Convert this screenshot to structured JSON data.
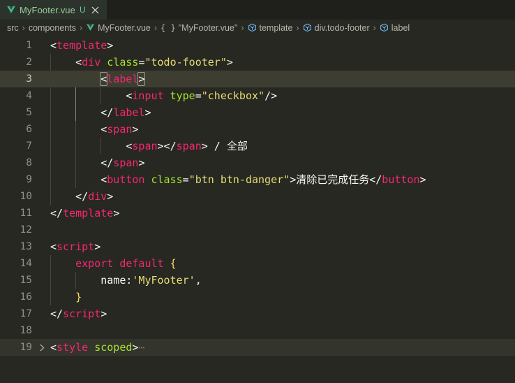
{
  "window": {
    "editor_bg": "#272822",
    "tabbar_bg": "#1f1f1c",
    "active_line_bg": "#3e3d32",
    "accent_green": "#73c991",
    "accent_blue": "#75beff"
  },
  "tabbar": {
    "tabs": [
      {
        "label": "MyFooter.vue",
        "icon": "vue-file-icon",
        "badge": "U",
        "close_icon": "close-icon",
        "active": true
      }
    ]
  },
  "breadcrumbs": {
    "separator": "›",
    "items": [
      {
        "label": "src",
        "icon": null
      },
      {
        "label": "components",
        "icon": null
      },
      {
        "label": "MyFooter.vue",
        "icon": "vue-file-icon"
      },
      {
        "label": "\"MyFooter.vue\"",
        "icon": "braces-icon"
      },
      {
        "label": "template",
        "icon": "symbol-field-icon"
      },
      {
        "label": "div.todo-footer",
        "icon": "symbol-field-icon"
      },
      {
        "label": "label",
        "icon": "symbol-field-icon"
      }
    ]
  },
  "editor": {
    "language": "vue",
    "active_line": 3,
    "cursor_line": 3,
    "lines": [
      {
        "num": "1",
        "indent": 0,
        "folded": false,
        "tokens": [
          {
            "t": "<",
            "c": "t-punc"
          },
          {
            "t": "template",
            "c": "t-tag"
          },
          {
            "t": ">",
            "c": "t-punc"
          }
        ]
      },
      {
        "num": "2",
        "indent": 1,
        "folded": false,
        "tokens": [
          {
            "t": "    ",
            "c": "t-plain"
          },
          {
            "t": "<",
            "c": "t-punc"
          },
          {
            "t": "div",
            "c": "t-tag"
          },
          {
            "t": " ",
            "c": "t-plain"
          },
          {
            "t": "class",
            "c": "t-attr"
          },
          {
            "t": "=",
            "c": "t-punc"
          },
          {
            "t": "\"todo-footer\"",
            "c": "t-str"
          },
          {
            "t": ">",
            "c": "t-punc"
          }
        ]
      },
      {
        "num": "3",
        "indent": 2,
        "folded": false,
        "active": true,
        "tokens": [
          {
            "t": "        ",
            "c": "t-plain"
          },
          {
            "t": "<",
            "c": "t-punc",
            "match": true
          },
          {
            "t": "label",
            "c": "t-tag"
          },
          {
            "t": ">",
            "c": "t-punc",
            "match": true
          }
        ]
      },
      {
        "num": "4",
        "indent": 3,
        "folded": false,
        "tokens": [
          {
            "t": "            ",
            "c": "t-plain"
          },
          {
            "t": "<",
            "c": "t-punc"
          },
          {
            "t": "input",
            "c": "t-tag"
          },
          {
            "t": " ",
            "c": "t-plain"
          },
          {
            "t": "type",
            "c": "t-attr"
          },
          {
            "t": "=",
            "c": "t-punc"
          },
          {
            "t": "\"checkbox\"",
            "c": "t-str"
          },
          {
            "t": "/>",
            "c": "t-punc"
          }
        ]
      },
      {
        "num": "5",
        "indent": 2,
        "folded": false,
        "tokens": [
          {
            "t": "        ",
            "c": "t-plain"
          },
          {
            "t": "</",
            "c": "t-punc"
          },
          {
            "t": "label",
            "c": "t-tag"
          },
          {
            "t": ">",
            "c": "t-punc"
          }
        ]
      },
      {
        "num": "6",
        "indent": 2,
        "folded": false,
        "tokens": [
          {
            "t": "        ",
            "c": "t-plain"
          },
          {
            "t": "<",
            "c": "t-punc"
          },
          {
            "t": "span",
            "c": "t-tag"
          },
          {
            "t": ">",
            "c": "t-punc"
          }
        ]
      },
      {
        "num": "7",
        "indent": 3,
        "folded": false,
        "tokens": [
          {
            "t": "            ",
            "c": "t-plain"
          },
          {
            "t": "<",
            "c": "t-punc"
          },
          {
            "t": "span",
            "c": "t-tag"
          },
          {
            "t": "></",
            "c": "t-punc"
          },
          {
            "t": "span",
            "c": "t-tag"
          },
          {
            "t": ">",
            "c": "t-punc"
          },
          {
            "t": " / ",
            "c": "t-plain"
          },
          {
            "t": "全部",
            "c": "t-plain cjk"
          }
        ]
      },
      {
        "num": "8",
        "indent": 2,
        "folded": false,
        "tokens": [
          {
            "t": "        ",
            "c": "t-plain"
          },
          {
            "t": "</",
            "c": "t-punc"
          },
          {
            "t": "span",
            "c": "t-tag"
          },
          {
            "t": ">",
            "c": "t-punc"
          }
        ]
      },
      {
        "num": "9",
        "indent": 2,
        "folded": false,
        "tokens": [
          {
            "t": "        ",
            "c": "t-plain"
          },
          {
            "t": "<",
            "c": "t-punc"
          },
          {
            "t": "button",
            "c": "t-tag"
          },
          {
            "t": " ",
            "c": "t-plain"
          },
          {
            "t": "class",
            "c": "t-attr"
          },
          {
            "t": "=",
            "c": "t-punc"
          },
          {
            "t": "\"btn btn-danger\"",
            "c": "t-str"
          },
          {
            "t": ">",
            "c": "t-punc"
          },
          {
            "t": "清除已完成任务",
            "c": "t-plain cjk"
          },
          {
            "t": "</",
            "c": "t-punc"
          },
          {
            "t": "button",
            "c": "t-tag"
          },
          {
            "t": ">",
            "c": "t-punc"
          }
        ]
      },
      {
        "num": "10",
        "indent": 1,
        "folded": false,
        "tokens": [
          {
            "t": "    ",
            "c": "t-plain"
          },
          {
            "t": "</",
            "c": "t-punc"
          },
          {
            "t": "div",
            "c": "t-tag"
          },
          {
            "t": ">",
            "c": "t-punc"
          }
        ]
      },
      {
        "num": "11",
        "indent": 0,
        "folded": false,
        "tokens": [
          {
            "t": "</",
            "c": "t-punc"
          },
          {
            "t": "template",
            "c": "t-tag"
          },
          {
            "t": ">",
            "c": "t-punc"
          }
        ]
      },
      {
        "num": "12",
        "indent": 0,
        "folded": false,
        "tokens": []
      },
      {
        "num": "13",
        "indent": 0,
        "folded": false,
        "tokens": [
          {
            "t": "<",
            "c": "t-punc"
          },
          {
            "t": "script",
            "c": "t-tag"
          },
          {
            "t": ">",
            "c": "t-punc"
          }
        ]
      },
      {
        "num": "14",
        "indent": 1,
        "folded": false,
        "tokens": [
          {
            "t": "    ",
            "c": "t-plain"
          },
          {
            "t": "export",
            "c": "t-kw"
          },
          {
            "t": " ",
            "c": "t-plain"
          },
          {
            "t": "default",
            "c": "t-kw"
          },
          {
            "t": " ",
            "c": "t-plain"
          },
          {
            "t": "{",
            "c": "t-brace1"
          }
        ]
      },
      {
        "num": "15",
        "indent": 2,
        "folded": false,
        "tokens": [
          {
            "t": "        ",
            "c": "t-plain"
          },
          {
            "t": "name",
            "c": "t-prop"
          },
          {
            "t": ":",
            "c": "t-punc"
          },
          {
            "t": "'MyFooter'",
            "c": "t-str"
          },
          {
            "t": ",",
            "c": "t-punc"
          }
        ]
      },
      {
        "num": "16",
        "indent": 1,
        "folded": false,
        "tokens": [
          {
            "t": "    ",
            "c": "t-plain"
          },
          {
            "t": "}",
            "c": "t-brace1"
          }
        ]
      },
      {
        "num": "17",
        "indent": 0,
        "folded": false,
        "tokens": [
          {
            "t": "</",
            "c": "t-punc"
          },
          {
            "t": "script",
            "c": "t-tag"
          },
          {
            "t": ">",
            "c": "t-punc"
          }
        ]
      },
      {
        "num": "18",
        "indent": 0,
        "folded": false,
        "tokens": []
      },
      {
        "num": "19",
        "indent": 0,
        "folded": true,
        "fold_chevron": "chevron-right-icon",
        "tokens": [
          {
            "t": "<",
            "c": "t-punc"
          },
          {
            "t": "style",
            "c": "t-tag"
          },
          {
            "t": " ",
            "c": "t-plain"
          },
          {
            "t": "scoped",
            "c": "t-attr"
          },
          {
            "t": ">",
            "c": "t-punc"
          },
          {
            "t": "⋯",
            "c": "t-fold"
          }
        ]
      }
    ]
  }
}
